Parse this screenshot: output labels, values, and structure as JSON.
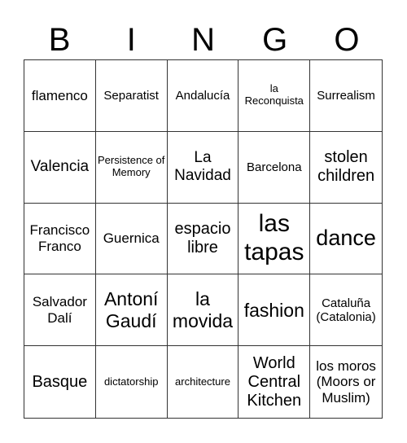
{
  "header": {
    "letters": [
      "B",
      "I",
      "N",
      "G",
      "O"
    ]
  },
  "cells": [
    [
      "flamenco",
      "Separatist",
      "Andalucía",
      "la Reconquista",
      "Surrealism"
    ],
    [
      "Valencia",
      "Persistence of Memory",
      "La Navidad",
      "Barcelona",
      "stolen children"
    ],
    [
      "Francisco Franco",
      "Guernica",
      "espacio libre",
      "las tapas",
      "dance"
    ],
    [
      "Salvador Dalí",
      "Antoní Gaudí",
      "la movida",
      "fashion",
      "Cataluña (Catalonia)"
    ],
    [
      "Basque",
      "dictatorship",
      "architecture",
      "World Central Kitchen",
      "los moros (Moors or Muslim)"
    ]
  ]
}
